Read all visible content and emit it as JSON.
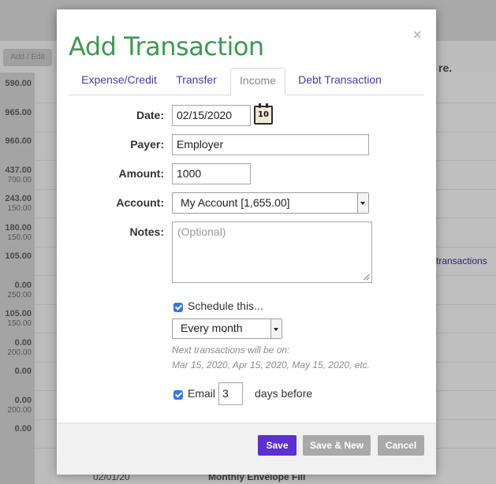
{
  "background": {
    "add_edit_label": "Add / Edit",
    "amounts": [
      {
        "value": "590.00",
        "sub": ""
      },
      {
        "value": "965.00",
        "sub": ""
      },
      {
        "value": "960.00",
        "sub": ""
      },
      {
        "value": "437.00",
        "sub": "700.00"
      },
      {
        "value": "243.00",
        "sub": "150.00"
      },
      {
        "value": "180.00",
        "sub": "150.00"
      },
      {
        "value": "105.00",
        "sub": ""
      },
      {
        "value": "0.00",
        "sub": "250.00"
      },
      {
        "value": "105.00",
        "sub": "150.00"
      },
      {
        "value": "0.00",
        "sub": "200.00"
      },
      {
        "value": "0.00",
        "sub": ""
      },
      {
        "value": "0.00",
        "sub": "200.00"
      },
      {
        "value": "0.00",
        "sub": ""
      }
    ],
    "right_fragment": "re.",
    "transactions_link": "transactions",
    "bottom_date": "02/01/20",
    "bottom_desc": "Monthly Envelope Fill"
  },
  "modal": {
    "title": "Add Transaction",
    "close_glyph": "×",
    "tabs": [
      {
        "label": "Expense/Credit",
        "active": false
      },
      {
        "label": "Transfer",
        "active": false
      },
      {
        "label": "Income",
        "active": true
      },
      {
        "label": "Debt Transaction",
        "active": false
      }
    ],
    "form": {
      "date_label": "Date:",
      "date_value": "02/15/2020",
      "calendar_day": "10",
      "payer_label": "Payer:",
      "payer_value": "Employer",
      "amount_label": "Amount:",
      "amount_value": "1000",
      "account_label": "Account:",
      "account_value": "My Account [1,655.00]",
      "notes_label": "Notes:",
      "notes_placeholder": "(Optional)",
      "schedule_label": "Schedule this...",
      "schedule_checked": true,
      "frequency_value": "Every month",
      "next_transactions_label": "Next transactions will be on:",
      "next_transactions_dates": "Mar 15, 2020, Apr 15, 2020, May 15, 2020, etc.",
      "email_label": "Email",
      "email_checked": true,
      "email_days_value": "3",
      "email_suffix": "days before"
    },
    "buttons": {
      "save": "Save",
      "save_new": "Save & New",
      "cancel": "Cancel"
    },
    "colors": {
      "title": "#3d9a52",
      "tab_link": "#4a3aa8",
      "save_button": "#5b2fd0",
      "secondary_button": "#a9a9a9",
      "checkbox": "#3478e0"
    }
  }
}
